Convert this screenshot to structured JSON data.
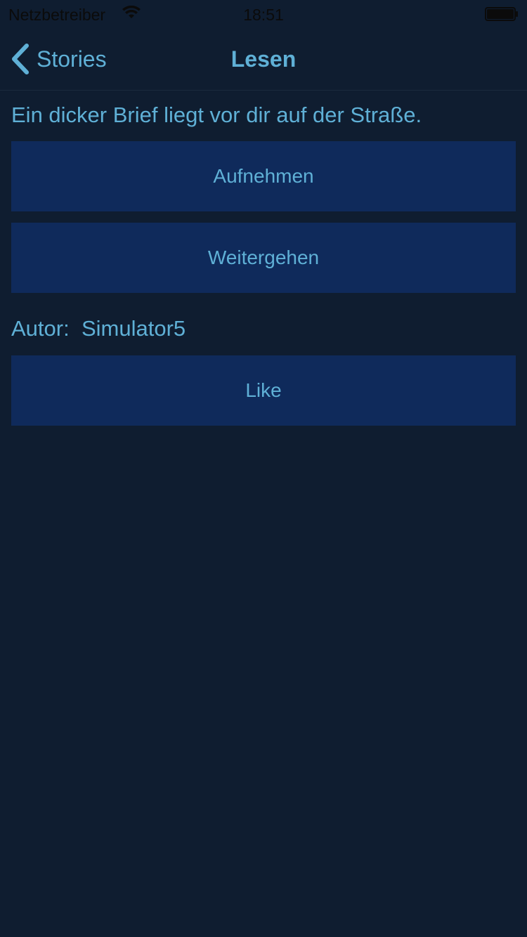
{
  "status_bar": {
    "carrier": "Netzbetreiber",
    "time": "18:51",
    "wifi_icon": "wifi-icon",
    "battery_icon": "battery-icon"
  },
  "nav": {
    "back_label": "Stories",
    "back_icon": "chevron-left-icon",
    "title": "Lesen"
  },
  "story": {
    "text": "Ein dicker Brief liegt vor dir auf der Straße.",
    "options": [
      "Aufnehmen",
      "Weitergehen"
    ]
  },
  "author": {
    "label": "Autor:",
    "name": "Simulator5"
  },
  "like_label": "Like",
  "colors": {
    "background": "#0f1d30",
    "accent_text": "#5fb0d6",
    "button_bg": "#0f2a5b"
  }
}
